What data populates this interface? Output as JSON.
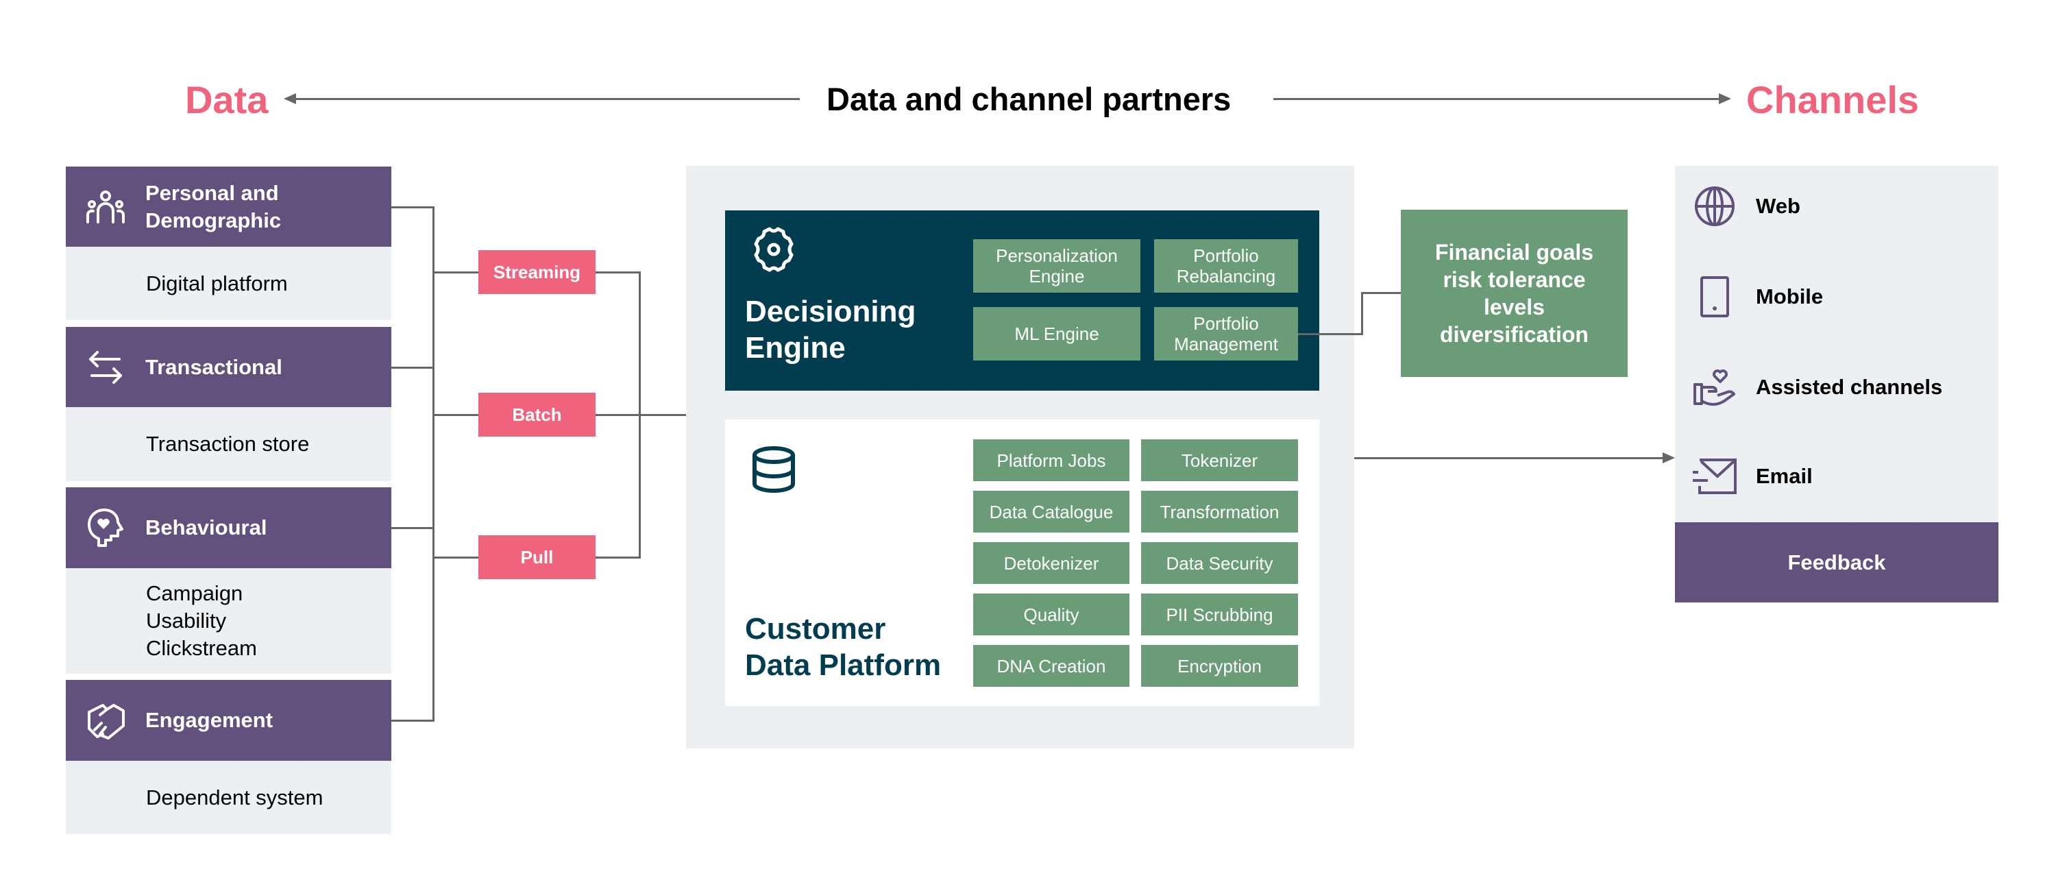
{
  "header": {
    "left_label": "Data",
    "title": "Data and channel partners",
    "right_label": "Channels"
  },
  "colors": {
    "accent_pink": "#f0637d",
    "purple": "#62507d",
    "dark_teal": "#023d4f",
    "green": "#6a9c78",
    "light_gray": "#ecf0f3",
    "connector": "#666666"
  },
  "data_sources": [
    {
      "title": "Personal and\nDemographic",
      "icon": "people-group-icon",
      "detail": "Digital platform"
    },
    {
      "title": "Transactional",
      "icon": "exchange-arrows-icon",
      "detail": "Transaction store"
    },
    {
      "title": "Behavioural",
      "icon": "head-heart-icon",
      "detail": "Campaign\nUsability\nClickstream"
    },
    {
      "title": "Engagement",
      "icon": "handshake-icon",
      "detail": "Dependent system"
    }
  ],
  "ingestion_methods": [
    "Streaming",
    "Batch",
    "Pull"
  ],
  "decisioning_engine": {
    "title": "Decisioning\nEngine",
    "icon": "gear-icon",
    "components": [
      "Personalization\nEngine",
      "Portfolio\nRebalancing",
      "ML Engine",
      "Portfolio\nManagement"
    ]
  },
  "customer_data_platform": {
    "title": "Customer\nData Platform",
    "icon": "database-icon",
    "components": [
      "Platform Jobs",
      "Tokenizer",
      "Data Catalogue",
      "Transformation",
      "Detokenizer",
      "Data Security",
      "Quality",
      "PII Scrubbing",
      "DNA Creation",
      "Encryption"
    ]
  },
  "portfolio_inputs": "Financial goals\nrisk tolerance\nlevels\ndiversification",
  "channels": {
    "items": [
      {
        "label": "Web",
        "icon": "globe-icon"
      },
      {
        "label": "Mobile",
        "icon": "mobile-phone-icon"
      },
      {
        "label": "Assisted channels",
        "icon": "hand-heart-icon"
      },
      {
        "label": "Email",
        "icon": "email-send-icon"
      }
    ],
    "feedback": "Feedback"
  }
}
